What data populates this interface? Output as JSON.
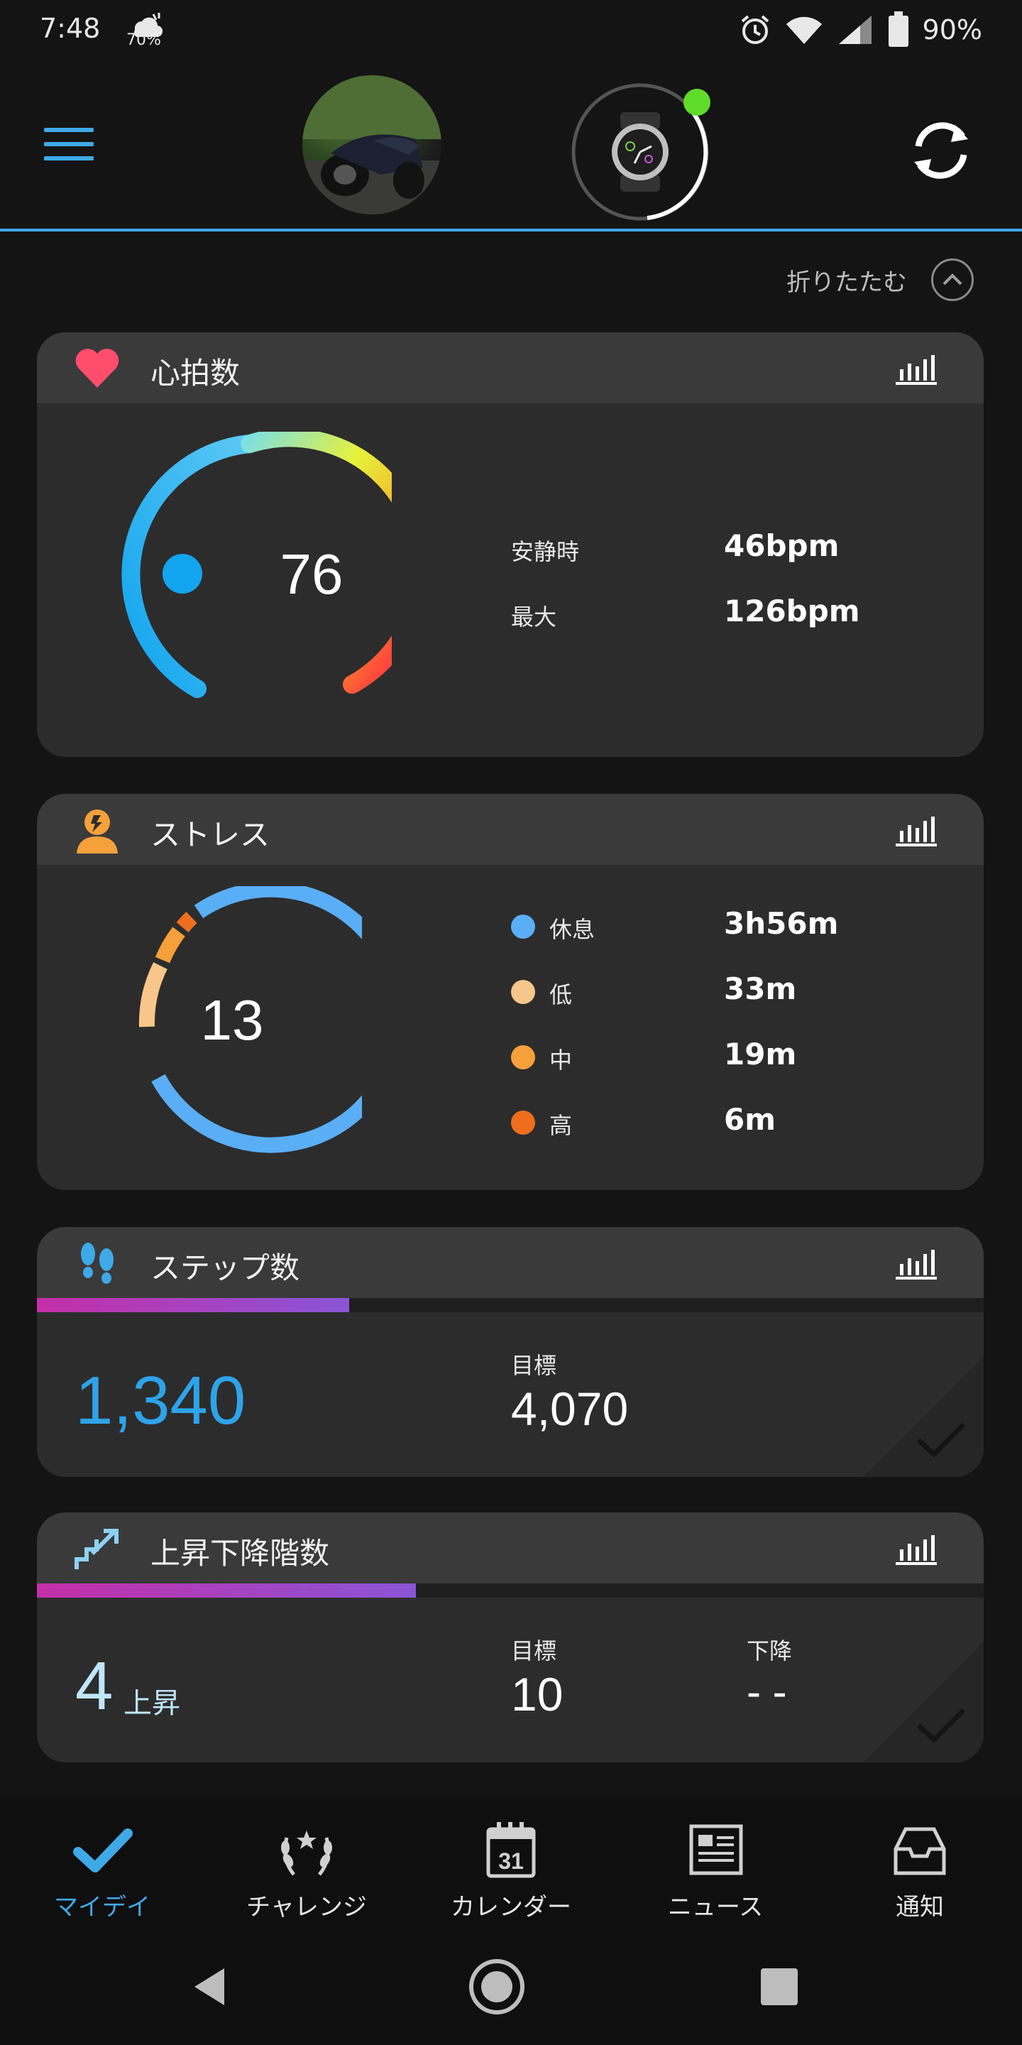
{
  "status_bar": {
    "time": "7:48",
    "weather_pct": "70%",
    "battery_pct": "90%"
  },
  "header": {
    "collapse_label": "折りたたむ"
  },
  "heart_rate": {
    "title": "心拍数",
    "current": "76",
    "resting_label": "安静時",
    "resting_value": "46bpm",
    "max_label": "最大",
    "max_value": "126bpm"
  },
  "stress": {
    "title": "ストレス",
    "level": "13",
    "items": [
      {
        "label": "休息",
        "value": "3h56m",
        "color": "#5aaef5"
      },
      {
        "label": "低",
        "value": "33m",
        "color": "#f8c58a"
      },
      {
        "label": "中",
        "value": "19m",
        "color": "#f5a03a"
      },
      {
        "label": "高",
        "value": "6m",
        "color": "#ee6e1e"
      }
    ]
  },
  "steps": {
    "title": "ステップ数",
    "value": "1,340",
    "goal_label": "目標",
    "goal_value": "4,070",
    "progress": 0.33
  },
  "floors": {
    "title": "上昇下降階数",
    "value": "4",
    "value_unit": "上昇",
    "goal_label": "目標",
    "goal_value": "10",
    "down_label": "下降",
    "down_value": "- -",
    "progress": 0.4
  },
  "bottom_nav": {
    "items": [
      {
        "label": "マイデイ",
        "icon": "checkmark-icon",
        "active": true
      },
      {
        "label": "チャレンジ",
        "icon": "laurel-icon",
        "active": false
      },
      {
        "label": "カレンダー",
        "icon": "calendar-icon",
        "active": false,
        "badge": "31"
      },
      {
        "label": "ニュース",
        "icon": "news-icon",
        "active": false
      },
      {
        "label": "通知",
        "icon": "inbox-icon",
        "active": false
      }
    ]
  },
  "colors": {
    "accent": "#3fa9e8",
    "card_bg": "#2c2c2c",
    "card_head": "#3a3a3a",
    "heart": "#ff4d6d",
    "stress_icon": "#f5a03a",
    "steps_icon": "#3fa9e8",
    "floors_icon": "#8fd0f5",
    "progress_gradient_start": "#c42fa8",
    "progress_gradient_end": "#8a55d6"
  }
}
